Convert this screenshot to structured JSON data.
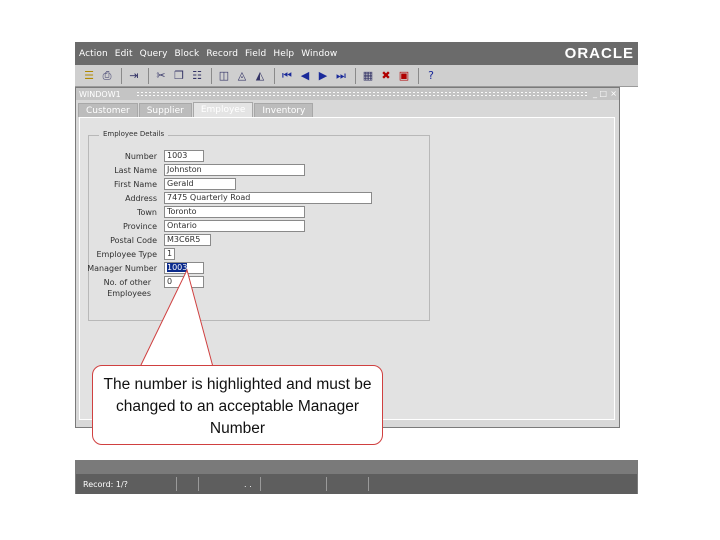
{
  "menu": [
    "Action",
    "Edit",
    "Query",
    "Block",
    "Record",
    "Field",
    "Help",
    "Window"
  ],
  "brand": "ORACLE",
  "toolbar": {
    "icons": [
      "open-folder-icon",
      "print-icon",
      "exit-icon",
      "cut-icon",
      "copy-icon",
      "paste-icon",
      "enter-query-icon",
      "execute-query-icon",
      "cancel-query-icon",
      "first-record-icon",
      "previous-record-icon",
      "next-record-icon",
      "last-record-icon",
      "insert-record-icon",
      "delete-record-icon",
      "lock-record-icon",
      "help-icon"
    ]
  },
  "window": {
    "title": "WINDOW1",
    "controls": {
      "min": "_",
      "max": "□",
      "close": "×"
    }
  },
  "tabs": [
    "Customer",
    "Supplier",
    "Employee",
    "Inventory"
  ],
  "active_tab": "Employee",
  "form": {
    "group_title": "Employee Details",
    "fields": [
      {
        "label": "Number",
        "value": "1003"
      },
      {
        "label": "Last Name",
        "value": "Johnston"
      },
      {
        "label": "First Name",
        "value": "Gerald"
      },
      {
        "label": "Address",
        "value": "7475 Quarterly Road"
      },
      {
        "label": "Town",
        "value": "Toronto"
      },
      {
        "label": "Province",
        "value": "Ontario"
      },
      {
        "label": "Postal Code",
        "value": "M3C6R5"
      },
      {
        "label": "Employee Type",
        "value": "1"
      },
      {
        "label": "Manager Number",
        "value": "1003"
      },
      {
        "label": "No. of other",
        "label2": "Employees",
        "value": "0"
      }
    ]
  },
  "status": {
    "record": "Record: 1/?",
    "dots": ". ."
  },
  "callout": {
    "text": "The number is highlighted and must be changed to an acceptable Manager Number"
  },
  "colors": {
    "menubar": "#6b6b6b",
    "selection": "#0a2a8c",
    "callout_border": "#d04040"
  }
}
